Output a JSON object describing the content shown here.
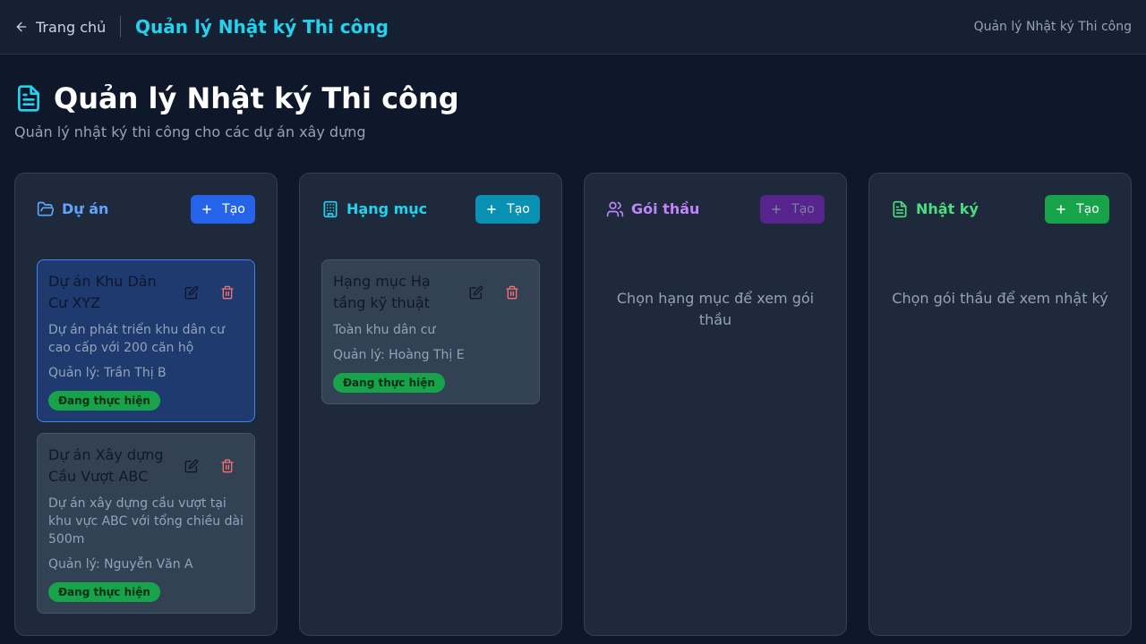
{
  "header": {
    "back_label": "Trang chủ",
    "title": "Quản lý Nhật ký Thi công",
    "breadcrumb": "Quản lý Nhật ký Thi công"
  },
  "page": {
    "title": "Quản lý Nhật ký Thi công",
    "subtitle": "Quản lý nhật ký thi công cho các dự án xây dựng"
  },
  "columns": [
    {
      "title": "Dự án",
      "create_label": "Tạo",
      "icon": "folder-open-icon",
      "accent": "#60a5fa",
      "button_color": "#2563eb"
    },
    {
      "title": "Hạng mục",
      "create_label": "Tạo",
      "icon": "building-icon",
      "accent": "#22d3ee",
      "button_color": "#0891b2"
    },
    {
      "title": "Gói thầu",
      "create_label": "Tạo",
      "icon": "users-icon",
      "accent": "#c084fc",
      "button_color": "#6b21a8",
      "placeholder": "Chọn hạng mục để xem gói thầu"
    },
    {
      "title": "Nhật ký",
      "create_label": "Tạo",
      "icon": "file-text-icon",
      "accent": "#4ade80",
      "button_color": "#16a34a",
      "placeholder": "Chọn gói thầu để xem nhật ký"
    }
  ],
  "projects": [
    {
      "name": "Dự án Khu Dân Cư XYZ",
      "description": "Dự án phát triển khu dân cư cao cấp với 200 căn hộ",
      "manager": "Quản lý: Trần Thị B",
      "status": "Đang thực hiện"
    },
    {
      "name": "Dự án Xây dựng Cầu Vượt ABC",
      "description": "Dự án xây dựng cầu vượt tại khu vực ABC với tổng chiều dài 500m",
      "manager": "Quản lý: Nguyễn Văn A",
      "status": "Đang thực hiện"
    }
  ],
  "categories": [
    {
      "name": "Hạng mục Hạ tầng kỹ thuật",
      "description": "Toàn khu dân cư",
      "manager": "Quản lý: Hoàng Thị E",
      "status": "Đang thực hiện"
    }
  ]
}
